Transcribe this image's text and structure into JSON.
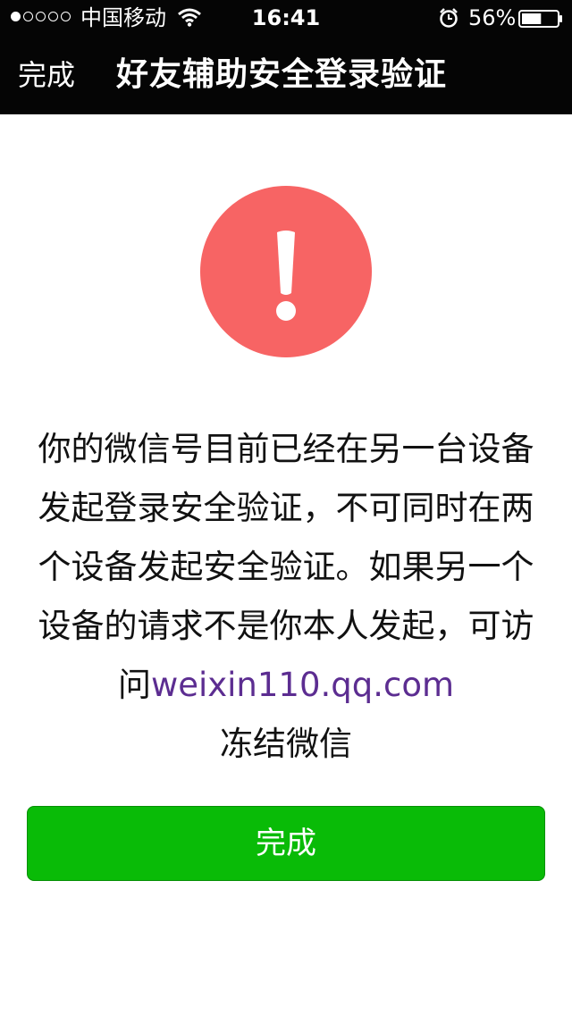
{
  "status_bar": {
    "carrier": "中国移动",
    "time": "16:41",
    "battery_percent": "56%",
    "signal_bars_filled": 1,
    "signal_bars_total": 5,
    "battery_level": 0.56
  },
  "nav": {
    "done_label": "完成",
    "title": "好友辅助安全登录验证"
  },
  "alert": {
    "icon": "exclamation-icon",
    "color": "#f76464"
  },
  "message": {
    "text_before": "你的微信号目前已经在另一台设备发起登录安全验证，不可同时在两个设备发起安全验证。如果另一个设备的请求不是你本人发起，可访问",
    "link": "weixin110.qq.com",
    "text_after": "冻结微信"
  },
  "button": {
    "label": "完成",
    "color": "#09bb07"
  }
}
